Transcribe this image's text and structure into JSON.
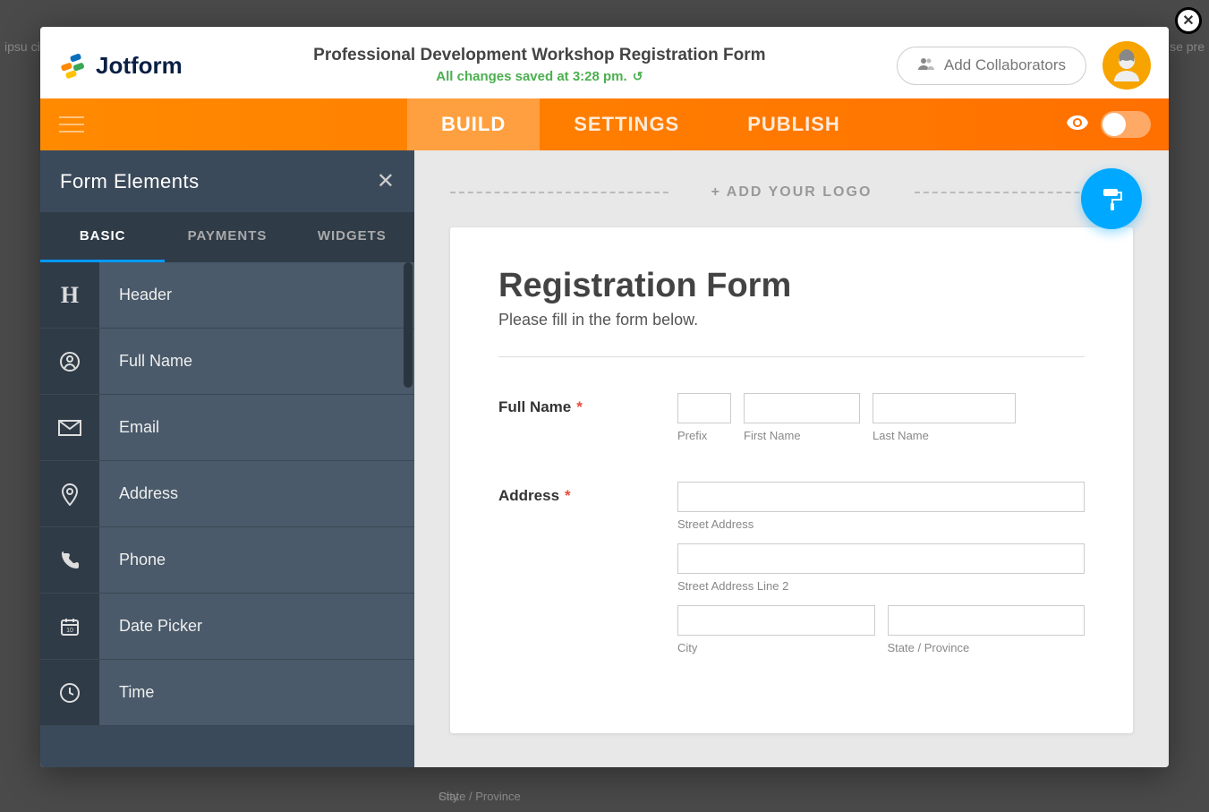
{
  "background_text": "ipsu\ncid\ntru\nt. E\na fu\nulpa",
  "background_text_right": "eit\nn ve\ncom\nse\npre",
  "header": {
    "brand": "Jotform",
    "form_title": "Professional Development Workshop Registration Form",
    "save_status": "All changes saved at 3:28 pm.",
    "collab_label": "Add Collaborators"
  },
  "nav": {
    "tabs": [
      "BUILD",
      "SETTINGS",
      "PUBLISH"
    ],
    "active": "BUILD"
  },
  "sidebar": {
    "title": "Form Elements",
    "tabs": [
      "BASIC",
      "PAYMENTS",
      "WIDGETS"
    ],
    "active": "BASIC",
    "elements": [
      {
        "icon": "H",
        "label": "Header"
      },
      {
        "icon": "user",
        "label": "Full Name"
      },
      {
        "icon": "mail",
        "label": "Email"
      },
      {
        "icon": "pin",
        "label": "Address"
      },
      {
        "icon": "phone",
        "label": "Phone"
      },
      {
        "icon": "calendar",
        "label": "Date Picker"
      },
      {
        "icon": "clock",
        "label": "Time"
      }
    ]
  },
  "canvas": {
    "add_logo": "+ ADD YOUR LOGO",
    "form_heading": "Registration Form",
    "form_sub": "Please fill in the form below.",
    "fields": {
      "fullname": {
        "label": "Full Name",
        "required": true,
        "subs": {
          "prefix": "Prefix",
          "first": "First Name",
          "last": "Last Name"
        }
      },
      "address": {
        "label": "Address",
        "required": true,
        "subs": {
          "street": "Street Address",
          "street2": "Street Address Line 2",
          "city": "City",
          "state": "State / Province"
        }
      }
    }
  },
  "footer": {
    "city": "City",
    "state": "State / Province"
  }
}
